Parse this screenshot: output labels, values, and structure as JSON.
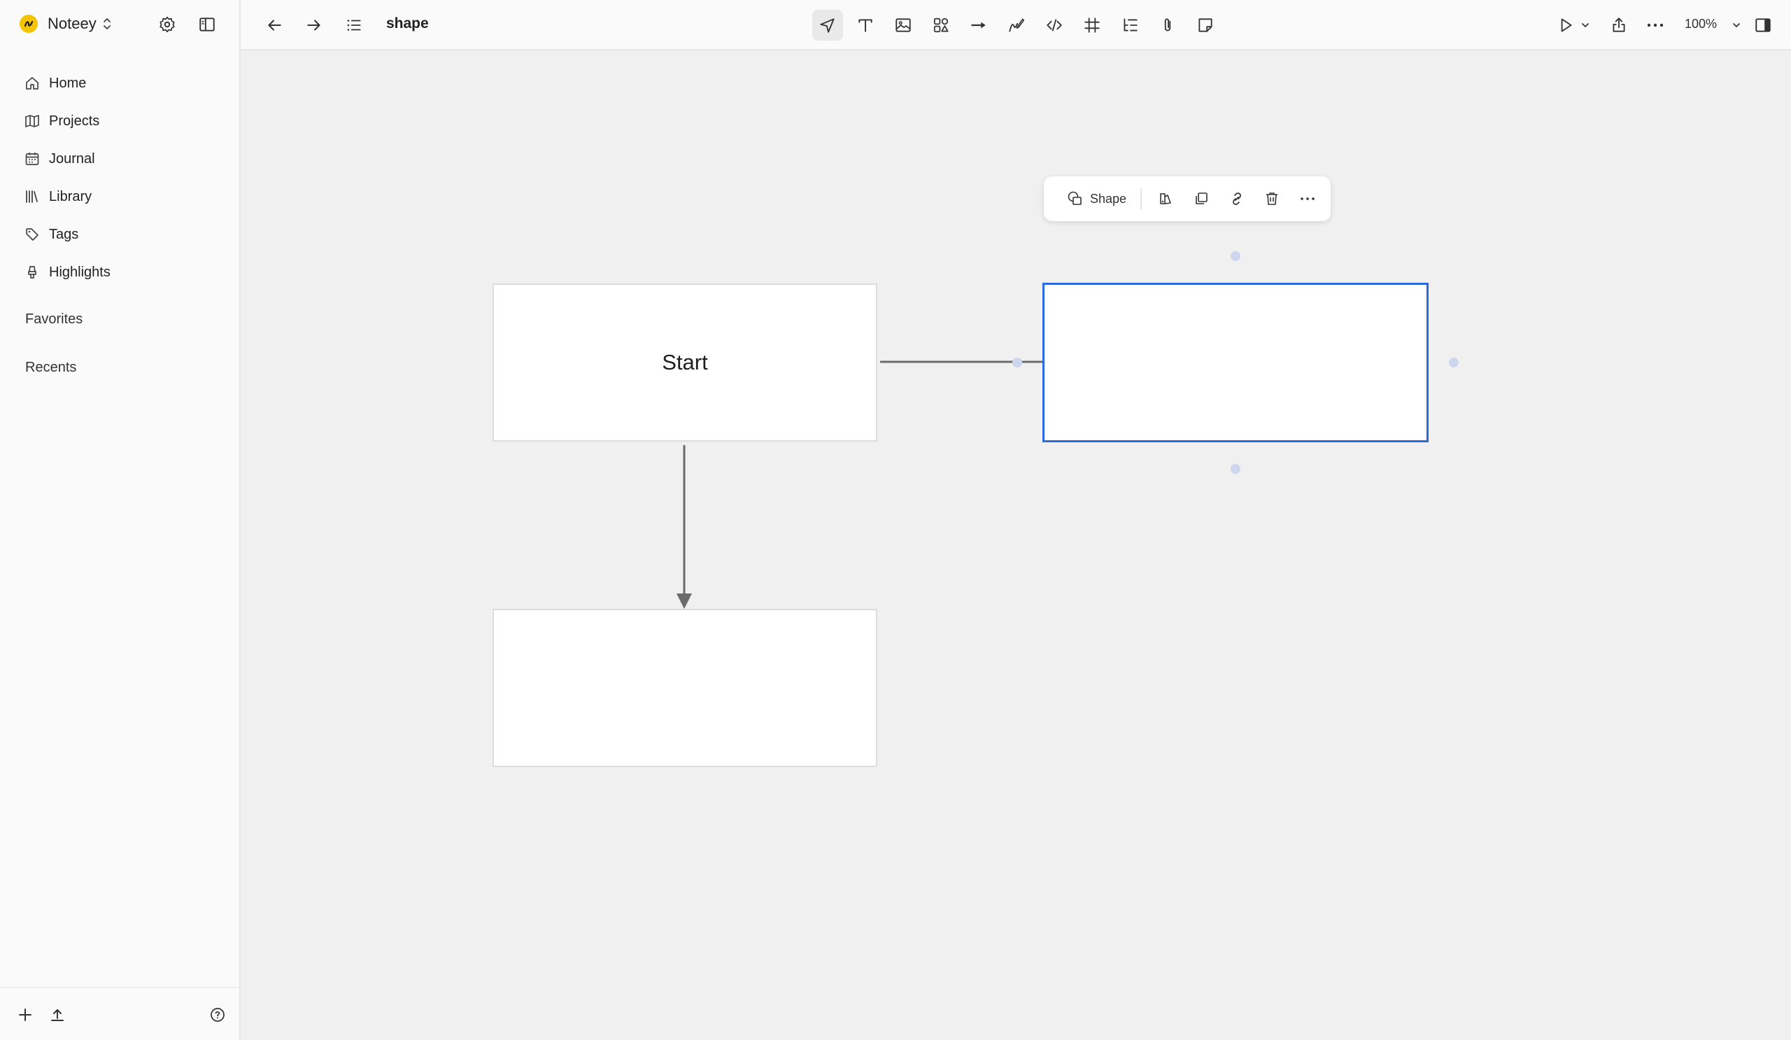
{
  "workspace": {
    "name": "Noteey",
    "logo_color": "#f5c400"
  },
  "sidebar": {
    "items": [
      {
        "label": "Home",
        "icon": "home-icon"
      },
      {
        "label": "Projects",
        "icon": "map-icon"
      },
      {
        "label": "Journal",
        "icon": "calendar-icon"
      },
      {
        "label": "Library",
        "icon": "library-icon"
      },
      {
        "label": "Tags",
        "icon": "tag-icon"
      },
      {
        "label": "Highlights",
        "icon": "highlighter-icon"
      }
    ],
    "favorites_label": "Favorites",
    "recents_label": "Recents"
  },
  "document": {
    "title": "shape"
  },
  "toolbar": {
    "tools": [
      "select-tool",
      "text-tool",
      "image-tool",
      "shapes-tool",
      "connector-tool",
      "pen-tool",
      "code-tool",
      "frame-tool",
      "outline-tool",
      "attachment-tool",
      "sticky-note-tool"
    ],
    "active_tool": "select-tool",
    "zoom": "100%"
  },
  "canvas": {
    "shapes": [
      {
        "id": "start",
        "label": "Start",
        "selected": false
      },
      {
        "id": "right",
        "label": "",
        "selected": true
      },
      {
        "id": "bottom",
        "label": "",
        "selected": false
      }
    ],
    "connectors": [
      {
        "from": "start",
        "to": "right"
      },
      {
        "from": "start",
        "to": "bottom"
      }
    ],
    "selection_color": "#2d68e0",
    "connector_color": "#6b6b6b"
  },
  "shape_toolbar": {
    "shape_label": "Shape",
    "actions": [
      "style-icon",
      "duplicate-icon",
      "link-icon",
      "delete-icon",
      "more-icon"
    ]
  }
}
